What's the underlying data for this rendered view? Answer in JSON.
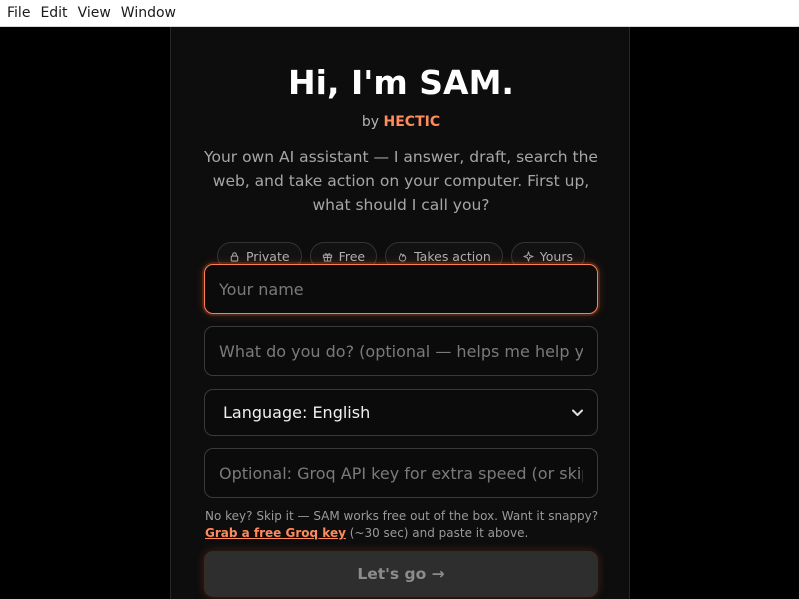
{
  "menubar": {
    "items": [
      "File",
      "Edit",
      "View",
      "Window"
    ]
  },
  "onboarding": {
    "title": "Hi, I'm SAM.",
    "by_prefix": "by",
    "brand": "HECTIC",
    "intro": "Your own AI assistant — I answer, draft, search the web, and take action on your computer. First up, what should I call you?",
    "chips": [
      {
        "label": "Private",
        "icon": "lock-icon"
      },
      {
        "label": "Free",
        "icon": "gift-icon"
      },
      {
        "label": "Takes action",
        "icon": "flame-icon"
      },
      {
        "label": "Yours",
        "icon": "sparkle-icon"
      }
    ],
    "name_field": {
      "value": "",
      "placeholder": "Your name"
    },
    "role_field": {
      "value": "",
      "placeholder": "What do you do? (optional — helps me help you)"
    },
    "language_select": {
      "value": "Language: English"
    },
    "api_key_field": {
      "value": "",
      "placeholder": "Optional: Groq API key for extra speed (or skip)"
    },
    "helper_text": "No key? Skip it — SAM works free out of the box. Want it snappy?",
    "helper_link": "Grab a free Groq key",
    "helper_suffix": "(~30 sec) and paste it above.",
    "submit_label": "Let's go →"
  },
  "colors": {
    "accent": "#ff8a5c",
    "focus_border": "#ff7f50",
    "background": "#000000",
    "panel": "#0d0d0d"
  }
}
